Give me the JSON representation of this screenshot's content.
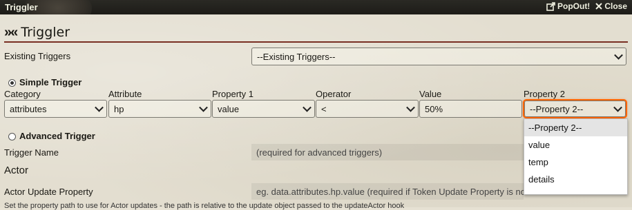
{
  "window": {
    "title": "Triggler",
    "popout_label": "PopOut!",
    "close_label": "Close"
  },
  "header": {
    "glyph": "»«",
    "title": "Triggler"
  },
  "existing": {
    "label": "Existing Triggers",
    "value": "--Existing Triggers--"
  },
  "simple": {
    "label": "Simple Trigger",
    "columns": [
      "Category",
      "Attribute",
      "Property 1",
      "Operator",
      "Value",
      "Property 2"
    ],
    "category": "attributes",
    "attribute": "hp",
    "property1": "value",
    "operator": "<",
    "value": "50%",
    "property2": "--Property 2--"
  },
  "advanced": {
    "label": "Advanced Trigger",
    "trigger_name_label": "Trigger Name",
    "trigger_name_placeholder": "(required for advanced triggers)",
    "actor_heading": "Actor",
    "actor_update_label": "Actor Update Property",
    "actor_update_placeholder": "eg. data.attributes.hp.value (required if Token Update Property is not set)",
    "hint": "Set the property path to use for Actor updates - the path is relative to the update object passed to the updateActor hook"
  },
  "property2_options": [
    "--Property 2--",
    "value",
    "temp",
    "details"
  ],
  "colors": {
    "accent": "#782e22",
    "focus": "#ff6400",
    "header_bg": "#1d1c18"
  }
}
